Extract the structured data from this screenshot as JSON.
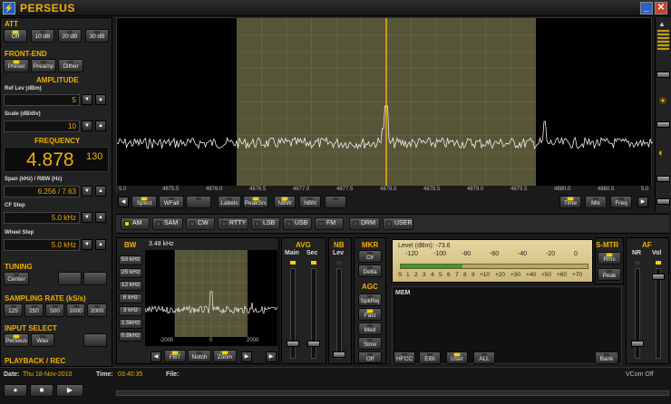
{
  "title": "PERSEUS",
  "att": {
    "label": "ATT",
    "buttons": [
      {
        "label": "Off",
        "on": true
      },
      {
        "label": "10 dB",
        "on": false
      },
      {
        "label": "20 dB",
        "on": false
      },
      {
        "label": "30 dB",
        "on": false
      }
    ]
  },
  "frontend": {
    "label": "FRONT-END",
    "buttons": [
      {
        "label": "Presel",
        "on": true
      },
      {
        "label": "Preamp",
        "on": false
      },
      {
        "label": "Dither",
        "on": false
      }
    ]
  },
  "amplitude": {
    "label": "AMPLITUDE",
    "ref_label": "Ref Lev (dBm)",
    "ref_value": "5",
    "scale_label": "Scale (dB/div)",
    "scale_value": "10"
  },
  "frequency": {
    "label": "FREQUENCY",
    "main": "4.878",
    "sub": "130",
    "span_label": "Span (kHz) / RBW (Hz)",
    "span_value": "6.256 / 7.63",
    "cf_label": "CF Step",
    "cf_value": "5.0 kHz",
    "wheel_label": "Wheel Step",
    "wheel_value": "5.0 kHz"
  },
  "tuning": {
    "label": "TUNING",
    "center": "Center"
  },
  "sampling": {
    "label": "SAMPLING RATE (kS/s)",
    "buttons": [
      {
        "label": "125",
        "on": false
      },
      {
        "label": "250",
        "on": false
      },
      {
        "label": "500",
        "on": false
      },
      {
        "label": "1000",
        "on": false
      },
      {
        "label": "2000",
        "on": false
      }
    ]
  },
  "input": {
    "label": "INPUT SELECT",
    "buttons": [
      {
        "label": "Perseus",
        "on": true
      },
      {
        "label": "Wav",
        "on": false
      }
    ]
  },
  "playback": {
    "label": "PLAYBACK / REC",
    "date_label": "Date:",
    "date": "Thu 18-Nov-2010",
    "time_label": "Time:",
    "time": "03:40:35",
    "file_label": "File:",
    "vcom": "VCom Off"
  },
  "spectrum": {
    "ticks": [
      "5.0",
      "4875.5",
      "4876.0",
      "4876.5",
      "4877.0",
      "4877.5",
      "4878.0",
      "4878.5",
      "4879.0",
      "4879.5",
      "4880.0",
      "4880.5",
      "5.0"
    ]
  },
  "spec_buttons": {
    "left": [
      {
        "label": "Spect",
        "on": true
      },
      {
        "label": "WFall",
        "on": false
      },
      {
        "label": "",
        "on": false
      }
    ],
    "mid": [
      {
        "label": "Labels",
        "on": false
      },
      {
        "label": "PeakSrc",
        "on": true
      },
      {
        "label": "NBW",
        "on": true
      },
      {
        "label": "NBN",
        "on": false
      },
      {
        "label": "",
        "on": false
      }
    ],
    "right": [
      {
        "label": "Time",
        "on": true
      },
      {
        "label": "Mix",
        "on": false
      },
      {
        "label": "Freq",
        "on": false
      }
    ]
  },
  "modes": [
    "AM",
    "SAM",
    "CW",
    "RTTY",
    "LSB",
    "USB",
    "FM",
    "DRM",
    "USER"
  ],
  "bw": {
    "label": "BW",
    "value": "3.48 kHz",
    "buttons": [
      "50 kHz",
      "25 kHz",
      "12 kHz",
      "6 kHz",
      "3 kHz",
      "1.5kHz",
      "0.8kHz"
    ],
    "ticks": [
      "-2000",
      "0",
      "2000"
    ],
    "bottom": [
      {
        "label": "FBT",
        "on": true
      },
      {
        "label": "Notch",
        "on": false
      },
      {
        "label": "Zoom",
        "on": true
      }
    ]
  },
  "avg": {
    "label": "AVG",
    "main": "Main",
    "sec": "Sec"
  },
  "nb": {
    "label": "NB",
    "lev": "Lev"
  },
  "mkr": {
    "label": "MKR",
    "buttons": [
      "Clr",
      "Delta"
    ]
  },
  "agc": {
    "label": "AGC",
    "buttons": [
      "SpkRej",
      "Fast",
      "Med",
      "Slow",
      "Off"
    ]
  },
  "level": {
    "text": "Level (dBm): -73.6",
    "ticks_top": [
      "-120",
      "-100",
      "-80",
      "-60",
      "-40",
      "-20",
      "0"
    ],
    "ticks_bottom": [
      "S",
      "1",
      "2",
      "3",
      "4",
      "5",
      "6",
      "7",
      "8",
      "9",
      "+10",
      "+20",
      "+30",
      "+40",
      "+50",
      "+60",
      "+70"
    ],
    "fraction": 0.33
  },
  "smtr": {
    "label": "S-MTR",
    "buttons": [
      "Rms",
      "Peak"
    ]
  },
  "af": {
    "label": "AF",
    "nr": "NR",
    "vol": "Vol"
  },
  "mem": {
    "label": "MEM",
    "buttons": [
      {
        "label": "HFCC",
        "on": false
      },
      {
        "label": "EiBi",
        "on": false
      },
      {
        "label": "User",
        "on": true
      },
      {
        "label": "ALL",
        "on": false
      }
    ],
    "bank": "Bank"
  }
}
